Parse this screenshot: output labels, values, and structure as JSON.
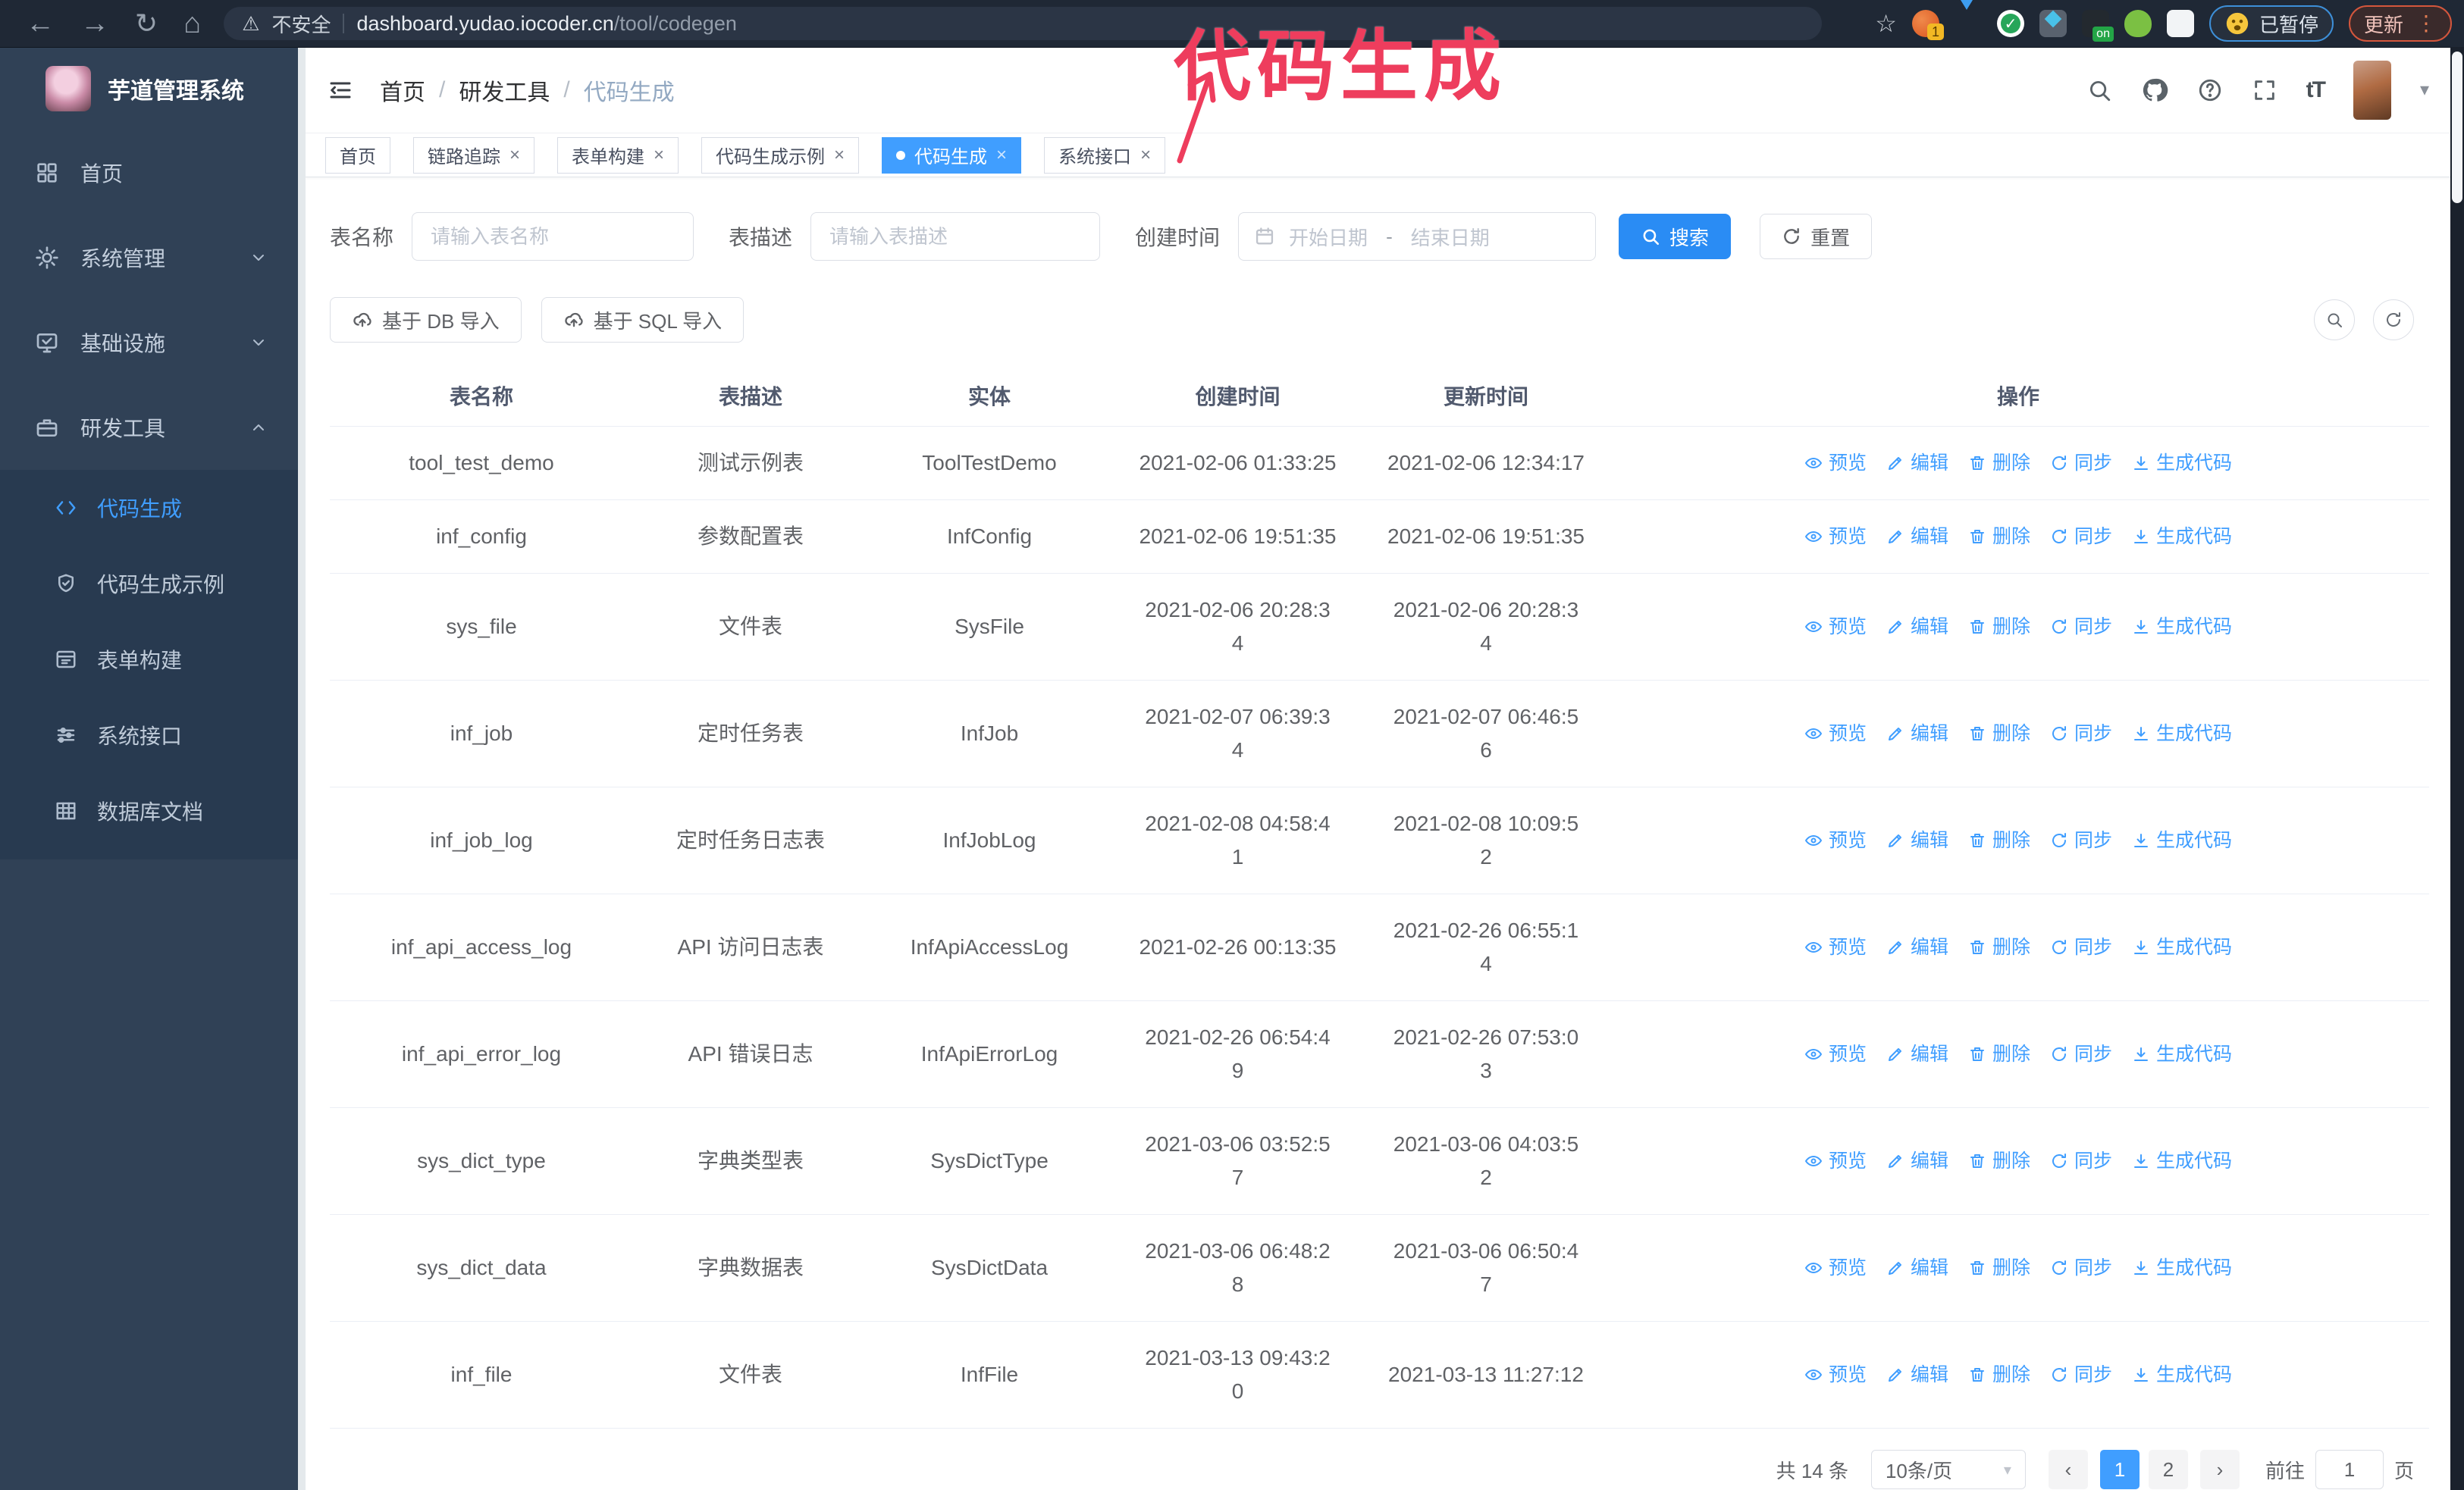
{
  "browser": {
    "security_label": "不安全",
    "url_host": "dashboard.yudao.iocoder.cn",
    "url_path": "/tool/codegen",
    "paused_badge": "已暂停",
    "update_button": "更新"
  },
  "annotation": {
    "text": "代码生成"
  },
  "sidebar": {
    "title": "芋道管理系统",
    "items": [
      {
        "key": "home",
        "icon": "home",
        "label": "首页"
      },
      {
        "key": "system",
        "icon": "gear",
        "label": "系统管理",
        "chevron": "down"
      },
      {
        "key": "infra",
        "icon": "monitor",
        "label": "基础设施",
        "chevron": "down"
      },
      {
        "key": "devtools",
        "icon": "briefcase",
        "label": "研发工具",
        "chevron": "up"
      }
    ],
    "submenu": [
      {
        "key": "codegen",
        "icon": "code",
        "label": "代码生成",
        "active": true
      },
      {
        "key": "codegen-example",
        "icon": "shield",
        "label": "代码生成示例"
      },
      {
        "key": "form-builder",
        "icon": "form",
        "label": "表单构建"
      },
      {
        "key": "system-api",
        "icon": "sliders",
        "label": "系统接口"
      },
      {
        "key": "db-doc",
        "icon": "tableic",
        "label": "数据库文档"
      }
    ]
  },
  "header": {
    "breadcrumb": [
      "首页",
      "研发工具",
      "代码生成"
    ]
  },
  "tags": [
    {
      "key": "home",
      "label": "首页",
      "closable": false,
      "active": false
    },
    {
      "key": "tracing",
      "label": "链路追踪",
      "closable": true,
      "active": false
    },
    {
      "key": "form-builder",
      "label": "表单构建",
      "closable": true,
      "active": false
    },
    {
      "key": "codegen-example",
      "label": "代码生成示例",
      "closable": true,
      "active": false
    },
    {
      "key": "codegen",
      "label": "代码生成",
      "closable": true,
      "active": true
    },
    {
      "key": "system-api",
      "label": "系统接口",
      "closable": true,
      "active": false
    }
  ],
  "filters": {
    "table_name_label": "表名称",
    "table_name_placeholder": "请输入表名称",
    "table_desc_label": "表描述",
    "table_desc_placeholder": "请输入表描述",
    "create_time_label": "创建时间",
    "date_start_placeholder": "开始日期",
    "date_separator": "-",
    "date_end_placeholder": "结束日期",
    "search_label": "搜索",
    "reset_label": "重置"
  },
  "toolbar": {
    "import_db": "基于 DB 导入",
    "import_sql": "基于 SQL 导入"
  },
  "table": {
    "columns": [
      "表名称",
      "表描述",
      "实体",
      "创建时间",
      "更新时间",
      "操作"
    ],
    "actions": [
      {
        "key": "preview",
        "label": "预览",
        "icon": "eye"
      },
      {
        "key": "edit",
        "label": "编辑",
        "icon": "pencil"
      },
      {
        "key": "delete",
        "label": "删除",
        "icon": "trash"
      },
      {
        "key": "sync",
        "label": "同步",
        "icon": "refresh"
      },
      {
        "key": "generate",
        "label": "生成代码",
        "icon": "download"
      }
    ],
    "rows": [
      {
        "name": "tool_test_demo",
        "desc": "测试示例表",
        "entity": "ToolTestDemo",
        "created": [
          "2021-02-06 01:33:25"
        ],
        "updated": [
          "2021-02-06 12:34:17"
        ]
      },
      {
        "name": "inf_config",
        "desc": "参数配置表",
        "entity": "InfConfig",
        "created": [
          "2021-02-06 19:51:35"
        ],
        "updated": [
          "2021-02-06 19:51:35"
        ]
      },
      {
        "name": "sys_file",
        "desc": "文件表",
        "entity": "SysFile",
        "created": [
          "2021-02-06 20:28:3",
          "4"
        ],
        "updated": [
          "2021-02-06 20:28:3",
          "4"
        ]
      },
      {
        "name": "inf_job",
        "desc": "定时任务表",
        "entity": "InfJob",
        "created": [
          "2021-02-07 06:39:3",
          "4"
        ],
        "updated": [
          "2021-02-07 06:46:5",
          "6"
        ]
      },
      {
        "name": "inf_job_log",
        "desc": "定时任务日志表",
        "entity": "InfJobLog",
        "created": [
          "2021-02-08 04:58:4",
          "1"
        ],
        "updated": [
          "2021-02-08 10:09:5",
          "2"
        ]
      },
      {
        "name": "inf_api_access_log",
        "desc": "API 访问日志表",
        "entity": "InfApiAccessLog",
        "created": [
          "2021-02-26 00:13:35"
        ],
        "updated": [
          "2021-02-26 06:55:1",
          "4"
        ]
      },
      {
        "name": "inf_api_error_log",
        "desc": "API 错误日志",
        "entity": "InfApiErrorLog",
        "created": [
          "2021-02-26 06:54:4",
          "9"
        ],
        "updated": [
          "2021-02-26 07:53:0",
          "3"
        ]
      },
      {
        "name": "sys_dict_type",
        "desc": "字典类型表",
        "entity": "SysDictType",
        "created": [
          "2021-03-06 03:52:5",
          "7"
        ],
        "updated": [
          "2021-03-06 04:03:5",
          "2"
        ]
      },
      {
        "name": "sys_dict_data",
        "desc": "字典数据表",
        "entity": "SysDictData",
        "created": [
          "2021-03-06 06:48:2",
          "8"
        ],
        "updated": [
          "2021-03-06 06:50:4",
          "7"
        ]
      },
      {
        "name": "inf_file",
        "desc": "文件表",
        "entity": "InfFile",
        "created": [
          "2021-03-13 09:43:2",
          "0"
        ],
        "updated": [
          "2021-03-13 11:27:12"
        ]
      }
    ]
  },
  "pagination": {
    "total_label": "共 14 条",
    "page_size_label": "10条/页",
    "pages": [
      "1",
      "2"
    ],
    "active_page": "1",
    "goto_label": "前往",
    "goto_value": "1",
    "goto_unit": "页"
  },
  "colors": {
    "accent": "#409eff",
    "sidebar": "#304156",
    "sidebar_sub": "#283a50",
    "chrome": "#1f2835",
    "annotation": "#ee3d5d"
  }
}
